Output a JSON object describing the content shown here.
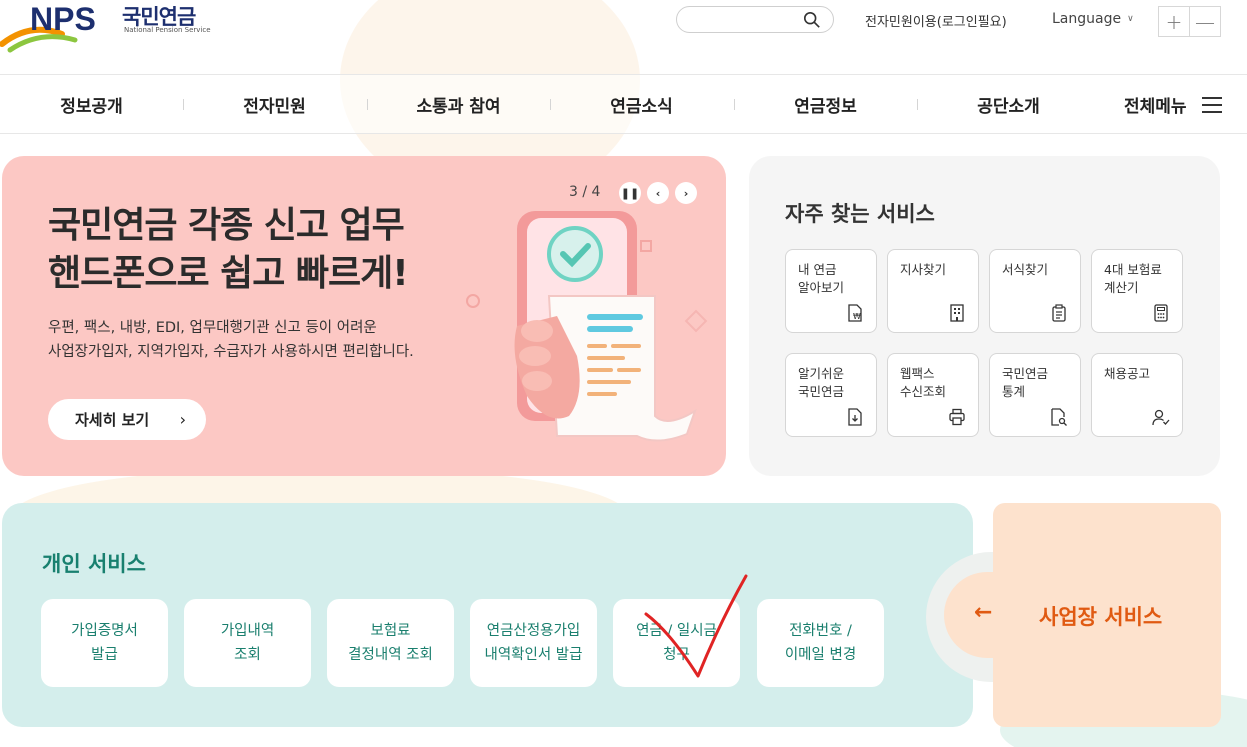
{
  "header": {
    "logo_mark": "NPS",
    "logo_text": "국민연금",
    "logo_sub": "National Pension Service",
    "search_placeholder": "",
    "login_link": "전자민원이용(로그인필요)",
    "language": "Language",
    "zoom_in": "+",
    "zoom_out": "—"
  },
  "gnb": {
    "items": [
      "정보공개",
      "전자민원",
      "소통과 참여",
      "연금소식",
      "연금정보",
      "공단소개"
    ],
    "all_menu": "전체메뉴"
  },
  "banner": {
    "title_line1": "국민연금 각종 신고 업무",
    "title_line2": "핸드폰으로 쉽고 빠르게!",
    "desc_line1": "우편, 팩스, 내방, EDI, 업무대행기관 신고 등이 어려운",
    "desc_line2": "사업장가입자, 지역가입자, 수급자가 사용하시면 편리합니다.",
    "button": "자세히 보기",
    "pager": "3 / 4",
    "bg_color": "#fcc8c4"
  },
  "frequent": {
    "title": "자주 찾는 서비스",
    "items": [
      {
        "label": "내 연금\n알아보기",
        "icon": "pension-doc-icon"
      },
      {
        "label": "지사찾기",
        "icon": "building-icon"
      },
      {
        "label": "서식찾기",
        "icon": "clipboard-icon"
      },
      {
        "label": "4대 보험료\n계산기",
        "icon": "calculator-icon"
      },
      {
        "label": "알기쉬운\n국민연금",
        "icon": "document-download-icon"
      },
      {
        "label": "웹팩스\n수신조회",
        "icon": "printer-icon"
      },
      {
        "label": "국민연금\n통계",
        "icon": "doc-search-icon"
      },
      {
        "label": "채용공고",
        "icon": "user-check-icon"
      }
    ]
  },
  "personal": {
    "title": "개인 서비스",
    "items": [
      "가입증명서\n발급",
      "가입내역\n조회",
      "보험료\n결정내역 조회",
      "연금산정용가입\n내역확인서 발급",
      "연금 / 일시금\n청구",
      "전화번호 /\n이메일 변경"
    ],
    "title_color": "#18806f"
  },
  "business": {
    "arrow": "←",
    "label": "사업장 서비스",
    "color": "#e05a12"
  }
}
